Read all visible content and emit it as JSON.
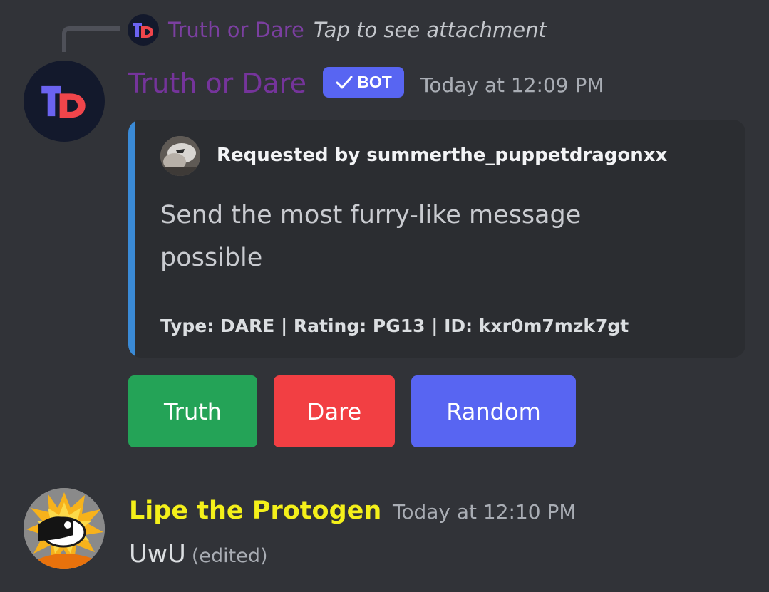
{
  "reply": {
    "author": "Truth or Dare",
    "text": "Tap to see attachment"
  },
  "bot_message": {
    "author": "Truth or Dare",
    "badge": "BOT",
    "timestamp": "Today at 12:09 PM",
    "avatar_icon": "td-logo-icon",
    "author_color": "#75349b"
  },
  "embed": {
    "accent_color": "#3a8ad6",
    "author": "Requested by summerthe_puppetdragonxx",
    "description": "Send the most furry-like message possible",
    "footer": "Type: DARE | Rating: PG13 | ID: kxr0m7mzk7gt"
  },
  "buttons": [
    {
      "label": "Truth",
      "color": "#24a357"
    },
    {
      "label": "Dare",
      "color": "#f23f43"
    },
    {
      "label": "Random",
      "color": "#5865f2"
    }
  ],
  "user_message": {
    "author": "Lipe the Protogen",
    "author_color": "#f4f01a",
    "timestamp": "Today at 12:10 PM",
    "text": "UwU",
    "edited": "(edited)"
  }
}
